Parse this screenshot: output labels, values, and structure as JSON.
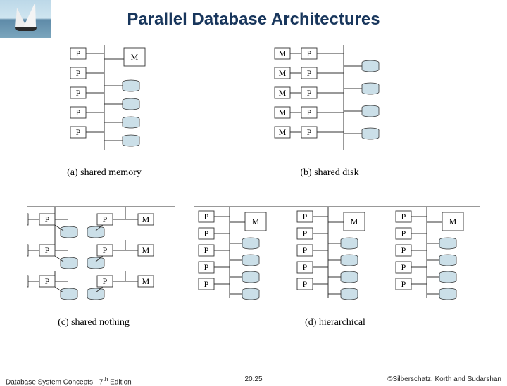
{
  "title": "Parallel Database Architectures",
  "labels": {
    "P": "P",
    "M": "M"
  },
  "captions": {
    "a": "(a) shared memory",
    "b": "(b) shared disk",
    "c": "(c) shared nothing",
    "d": "(d) hierarchical"
  },
  "architectures": {
    "shared_memory": {
      "processors": 5,
      "memory_modules": 1,
      "disks": 4,
      "shared_bus": true
    },
    "shared_disk": {
      "nodes": 5,
      "each_node": [
        "M",
        "P"
      ],
      "disks": 4,
      "shared_bus": true
    },
    "shared_nothing": {
      "nodes": 6,
      "each_node": [
        "M",
        "P",
        "disk"
      ],
      "shared_bus": true
    },
    "hierarchical": {
      "clusters": 3,
      "each_cluster": {
        "processors": 5,
        "memory_modules": 1,
        "disks": 4
      },
      "top_bus": true
    }
  },
  "footer": {
    "left": "Database System Concepts - 7th Edition",
    "edition_ordinal": "th",
    "center": "20.25",
    "right": "©Silberschatz, Korth and Sudarshan"
  }
}
